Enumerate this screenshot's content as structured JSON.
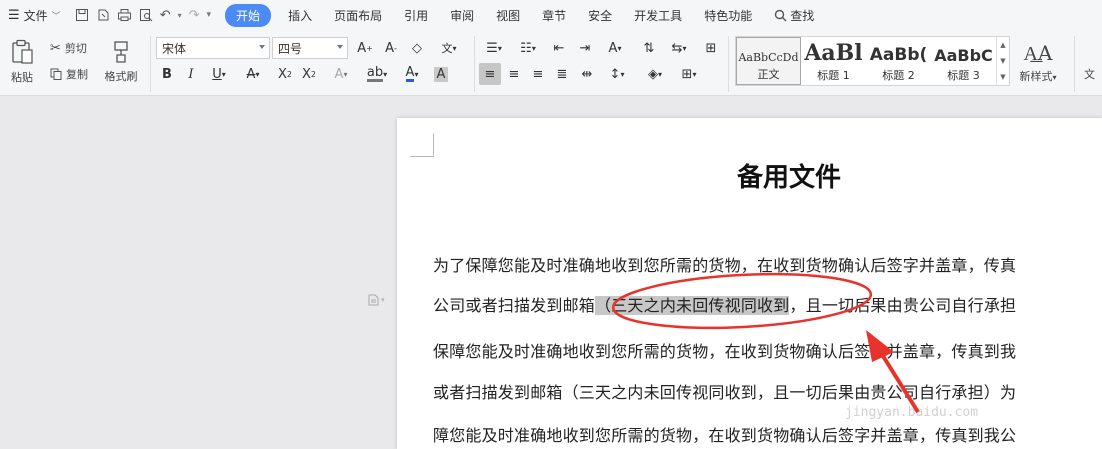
{
  "menu": {
    "file_label": "文件",
    "tabs": [
      "开始",
      "插入",
      "页面布局",
      "引用",
      "审阅",
      "视图",
      "章节",
      "安全",
      "开发工具",
      "特色功能"
    ],
    "active_tab": "开始",
    "search_label": "查找"
  },
  "ribbon": {
    "paste_label": "粘贴",
    "cut_label": "剪切",
    "copy_label": "复制",
    "format_painter_label": "格式刷",
    "font_name": "宋体",
    "font_size": "四号",
    "styles": [
      {
        "preview": "AaBbCcDd",
        "label": "正文"
      },
      {
        "preview": "AaBl",
        "label": "标题 1"
      },
      {
        "preview": "AaBb(",
        "label": "标题 2"
      },
      {
        "preview": "AaBbC",
        "label": "标题 3"
      }
    ],
    "new_style_label": "新样式",
    "more_label": "文"
  },
  "document": {
    "title": "备用文件",
    "lines": [
      {
        "text": "为了保障您能及时准确地收到您所需的货物，在收到货物确认后签字并盖章，传真"
      },
      {
        "before": "公司或者扫描发到邮箱",
        "highlight": "（三天之内未回传视同收到",
        "after": "，且一切后果由贵公司自行承担"
      },
      {
        "text": "保障您能及时准确地收到您所需的货物，在收到货物确认后签字并盖章，传真到我"
      },
      {
        "text": "或者扫描发到邮箱（三天之内未回传视同收到，且一切后果由贵公司自行承担）为"
      },
      {
        "text": "障您能及时准确地收到您所需的货物，在收到货物确认后签字并盖章，传真到我公"
      }
    ]
  },
  "watermark": "jingyan.baidu.com",
  "colors": {
    "accent": "#4c8bf5",
    "annotation": "#e8332c",
    "highlight": "#c7c7c7"
  }
}
